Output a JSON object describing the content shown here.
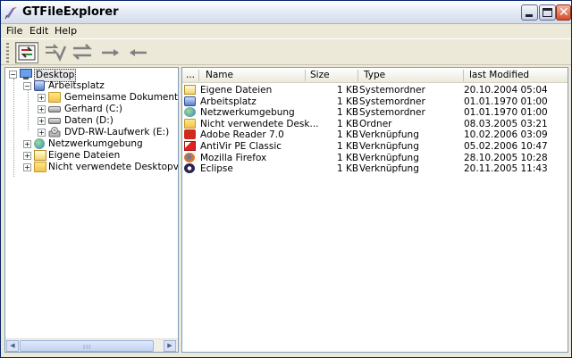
{
  "window": {
    "title": "GTFileExplorer"
  },
  "menu": [
    "File",
    "Edit",
    "Help"
  ],
  "toolbar": {
    "buttons": [
      {
        "icon": "sync-panels-icon",
        "active": true
      },
      {
        "icon": "compare-arrows-icon",
        "active": false
      },
      {
        "icon": "swap-arrows-icon",
        "active": false
      },
      {
        "icon": "arrow-right-icon",
        "active": false
      },
      {
        "icon": "arrow-left-icon",
        "active": false
      }
    ]
  },
  "tree": [
    {
      "label": "Desktop",
      "icon": "desktop-icon",
      "selected": true,
      "expander": "-"
    },
    {
      "label": "Arbeitsplatz",
      "icon": "computer-icon",
      "expander": "-"
    },
    {
      "label": "Gemeinsame Dokumente",
      "icon": "folder-icon",
      "expander": "+"
    },
    {
      "label": "Gerhard (C:)",
      "icon": "drive-icon",
      "expander": "+"
    },
    {
      "label": "Daten (D:)",
      "icon": "drive-icon",
      "expander": "+"
    },
    {
      "label": "DVD-RW-Laufwerk (E:)",
      "icon": "dvd-drive-icon",
      "expander": "+"
    },
    {
      "label": "Netzwerkumgebung",
      "icon": "network-icon",
      "expander": "+"
    },
    {
      "label": "Eigene Dateien",
      "icon": "documents-icon",
      "expander": "+"
    },
    {
      "label": "Nicht verwendete Desktopverkn",
      "icon": "folder-icon",
      "expander": "+"
    }
  ],
  "scrollbar": {
    "grip": "III"
  },
  "list": {
    "columns": [
      "...",
      "Name",
      "Size",
      "Type",
      "last Modified"
    ],
    "rows": [
      {
        "name": "Eigene Dateien",
        "size": "1 KB",
        "type": "Systemordner",
        "modified": "20.10.2004 05:04",
        "icon": "documents-icon"
      },
      {
        "name": "Arbeitsplatz",
        "size": "1 KB",
        "type": "Systemordner",
        "modified": "01.01.1970 01:00",
        "icon": "computer-icon"
      },
      {
        "name": "Netzwerkumgebung",
        "size": "1 KB",
        "type": "Systemordner",
        "modified": "01.01.1970 01:00",
        "icon": "network-icon"
      },
      {
        "name": "Nicht verwendete Desk...",
        "size": "1 KB",
        "type": "Ordner",
        "modified": "08.03.2005 03:21",
        "icon": "folder-icon"
      },
      {
        "name": "Adobe Reader 7.0",
        "size": "1 KB",
        "type": "Verknüpfung",
        "modified": "10.02.2006 03:09",
        "icon": "acrobat-icon"
      },
      {
        "name": "AntiVir PE Classic",
        "size": "1 KB",
        "type": "Verknüpfung",
        "modified": "05.02.2006 10:47",
        "icon": "antivir-icon"
      },
      {
        "name": "Mozilla Firefox",
        "size": "1 KB",
        "type": "Verknüpfung",
        "modified": "28.10.2005 10:28",
        "icon": "firefox-icon"
      },
      {
        "name": "Eclipse",
        "size": "1 KB",
        "type": "Verknüpfung",
        "modified": "20.11.2005 11:43",
        "icon": "eclipse-icon"
      }
    ]
  }
}
